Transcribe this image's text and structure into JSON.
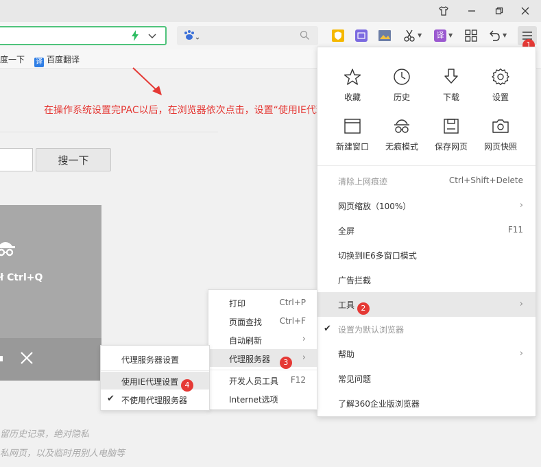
{
  "toolbar": {
    "translate_glyph": "译",
    "bolt_color": "#2ebd62"
  },
  "bookmarks": [
    {
      "label": "度一下"
    },
    {
      "label": "百度翻译",
      "icon_text": "译"
    }
  ],
  "page": {
    "annotation": "在操作系统设置完PAC以后，在浏览器依次点击，设置“使用IE代理设置”",
    "search_button": "搜一下",
    "incognito_shortcut": "ł Ctrl+Q",
    "footnotes": [
      "留历史记录，绝对隐私",
      "私网页，以及临时用别人电脑等"
    ]
  },
  "main_menu": {
    "grid": [
      {
        "label": "收藏",
        "icon": "star-icon"
      },
      {
        "label": "历史",
        "icon": "clock-icon"
      },
      {
        "label": "下载",
        "icon": "download-icon"
      },
      {
        "label": "设置",
        "icon": "gear-icon"
      },
      {
        "label": "新建窗口",
        "icon": "window-icon"
      },
      {
        "label": "无痕模式",
        "icon": "incognito-icon"
      },
      {
        "label": "保存网页",
        "icon": "save-icon"
      },
      {
        "label": "网页快照",
        "icon": "camera-icon"
      }
    ],
    "items": [
      {
        "label": "清除上网痕迹",
        "shortcut": "Ctrl+Shift+Delete"
      },
      {
        "label": "网页缩放（100%）",
        "arrow": "›"
      },
      {
        "label": "全屏",
        "shortcut": "F11"
      },
      {
        "label": "切换到IE6多窗口模式"
      },
      {
        "label": "广告拦截"
      },
      {
        "label": "工具",
        "arrow": "›"
      },
      {
        "label": "设置为默认浏览器"
      },
      {
        "label": "帮助",
        "arrow": "›"
      },
      {
        "label": "常见问题"
      },
      {
        "label": "了解360企业版浏览器"
      }
    ]
  },
  "tools_menu": {
    "items": [
      {
        "label": "打印",
        "shortcut": "Ctrl+P"
      },
      {
        "label": "页面查找",
        "shortcut": "Ctrl+F"
      },
      {
        "label": "自动刷新",
        "arrow": "›"
      },
      {
        "label": "代理服务器",
        "arrow": "›"
      },
      {
        "label": "开发人员工具",
        "shortcut": "F12"
      },
      {
        "label": "Internet选项"
      }
    ]
  },
  "proxy_menu": {
    "items": [
      {
        "label": "代理服务器设置"
      },
      {
        "label": "使用IE代理设置"
      },
      {
        "label": "不使用代理服务器"
      }
    ]
  },
  "badges": [
    "1",
    "2",
    "3",
    "4"
  ],
  "check_glyph": "✔",
  "close_glyph": "✕",
  "colors": {
    "accent_green": "#4fc37b",
    "annotation_red": "#e53935",
    "badge_red": "#e53935"
  }
}
